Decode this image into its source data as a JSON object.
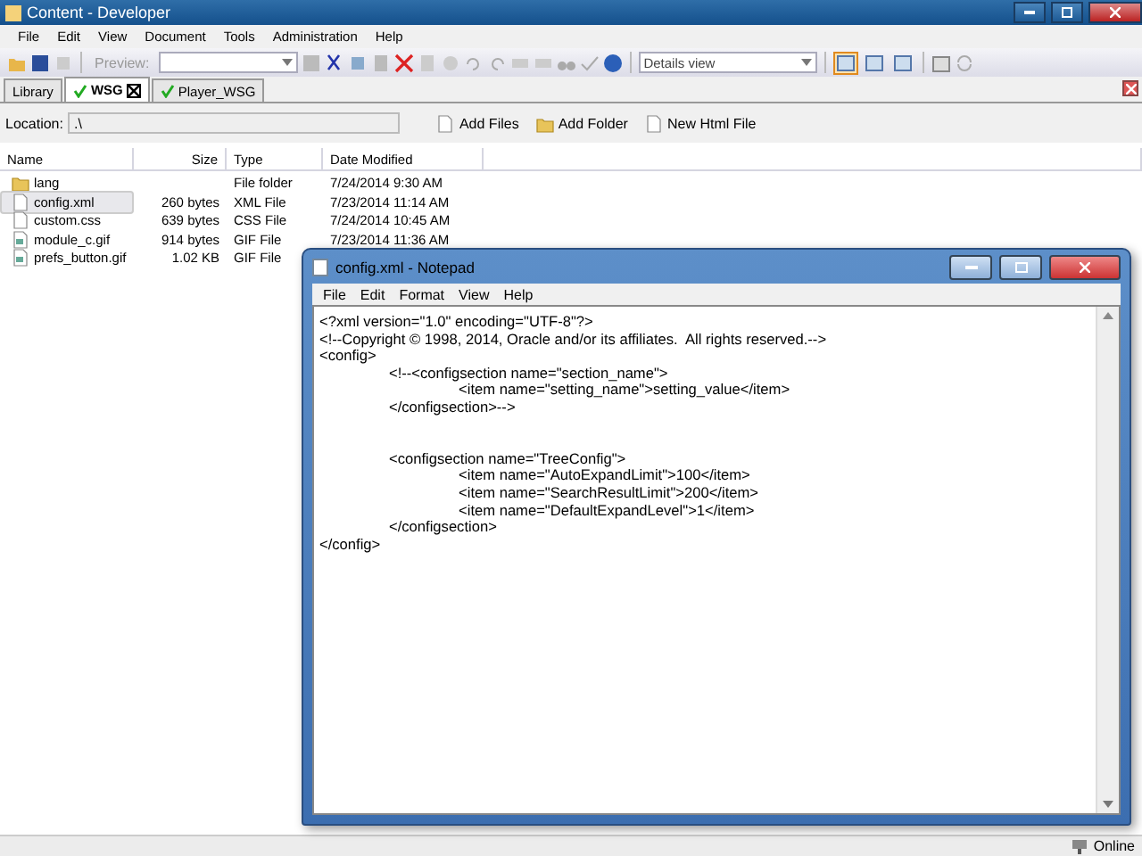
{
  "window": {
    "title": "Content - Developer"
  },
  "menu": [
    "File",
    "Edit",
    "View",
    "Document",
    "Tools",
    "Administration",
    "Help"
  ],
  "toolbar": {
    "preview_label": "Preview:",
    "view_select": "Details view",
    "view_modes": [
      {
        "selected": true
      },
      {
        "selected": false
      },
      {
        "selected": false
      }
    ]
  },
  "tabs": [
    {
      "label": "Library",
      "selected": false,
      "checked": false,
      "closable": false
    },
    {
      "label": "WSG",
      "selected": true,
      "checked": true,
      "closable": true
    },
    {
      "label": "Player_WSG",
      "selected": false,
      "checked": true,
      "closable": false
    }
  ],
  "location": {
    "label": "Location:",
    "value": ".\\",
    "actions": [
      "Add Files",
      "Add Folder",
      "New Html File"
    ]
  },
  "table": {
    "columns": [
      "Name",
      "Size",
      "Type",
      "Date Modified"
    ],
    "rows": [
      {
        "kind": "folder",
        "name": "lang",
        "size": "",
        "type": "File folder",
        "date": "7/24/2014 9:30 AM",
        "selected": false
      },
      {
        "kind": "file",
        "name": "config.xml",
        "size": "260 bytes",
        "type": "XML File",
        "date": "7/23/2014 11:14 AM",
        "selected": true
      },
      {
        "kind": "file",
        "name": "custom.css",
        "size": "639 bytes",
        "type": "CSS File",
        "date": "7/24/2014 10:45 AM",
        "selected": false
      },
      {
        "kind": "image",
        "name": "module_c.gif",
        "size": "914 bytes",
        "type": "GIF File",
        "date": "7/23/2014 11:36 AM",
        "selected": false
      },
      {
        "kind": "image",
        "name": "prefs_button.gif",
        "size": "1.02 KB",
        "type": "GIF File",
        "selected": false
      }
    ]
  },
  "notepad": {
    "title": "config.xml - Notepad",
    "menu": [
      "File",
      "Edit",
      "Format",
      "View",
      "Help"
    ],
    "blocks": [
      [
        "<?xml version=\"1.0\" encoding=\"UTF-8\"?>",
        "<!--Copyright © 1998, 2014, Oracle and/or its affiliates.  All rights reserved.-->",
        "<config>",
        "\t<!--<configsection name=\"section_name\">",
        "\t\t<item name=\"setting_name\">setting_value</item>",
        "\t</configsection>-->"
      ],
      [
        "\t<configsection name=\"TreeConfig\">",
        "\t\t<item name=\"AutoExpandLimit\">100</item>",
        "\t\t<item name=\"SearchResultLimit\">200</item>",
        "\t\t<item name=\"DefaultExpandLevel\">1</item>",
        "\t</configsection>",
        "</config>"
      ]
    ]
  },
  "status_bar": {
    "connection": "Online"
  }
}
